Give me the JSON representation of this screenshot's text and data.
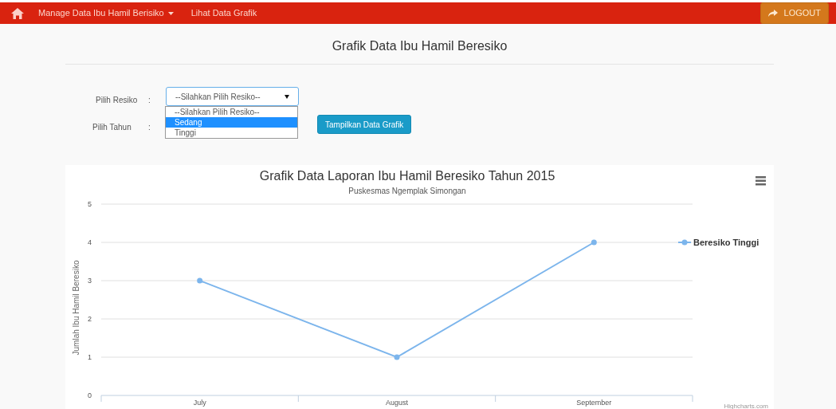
{
  "navbar": {
    "menu": [
      {
        "label": "Manage Data Ibu Hamil Berisiko",
        "dropdown": true
      },
      {
        "label": "Lihat Data Grafik",
        "dropdown": false
      }
    ],
    "logout": "LOGOUT"
  },
  "page_title": "Grafik Data Ibu Hamil Beresiko",
  "form": {
    "resiko_label": "Pilih Resiko",
    "tahun_label": "Pilih Tahun",
    "colon": ":",
    "resiko_value": "--Silahkan Pilih Resiko--",
    "options": [
      {
        "label": "--Silahkan Pilih Resiko--",
        "selected": false
      },
      {
        "label": "Sedang",
        "selected": true
      },
      {
        "label": "Tinggi",
        "selected": false
      }
    ],
    "submit": "Tampilkan Data Grafik"
  },
  "chart": {
    "subtitle": "Puskesmas Ngemplak Simongan",
    "credit": "Highcharts.com",
    "chart_data": {
      "type": "line",
      "title": "Grafik Data Laporan Ibu Hamil Beresiko Tahun 2015",
      "ylabel": "Jumlah Ibu Hamil Beresiko",
      "categories": [
        "July",
        "August",
        "September"
      ],
      "series": [
        {
          "name": "Beresiko Tinggi",
          "color": "#7cb5ec",
          "marker": true,
          "values": [
            3,
            1,
            4
          ]
        }
      ],
      "grid": true,
      "ylim": [
        0,
        5
      ],
      "yticks": [
        0,
        1,
        2,
        3,
        4,
        5
      ]
    }
  }
}
